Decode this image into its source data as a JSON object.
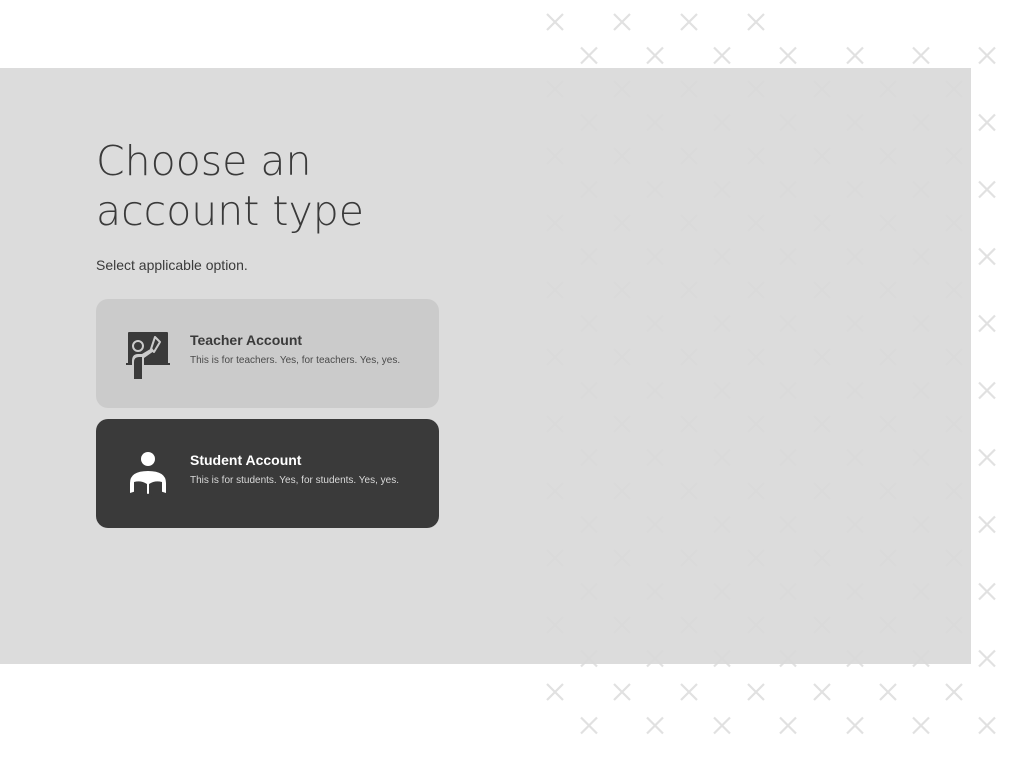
{
  "heading": {
    "line1": "Choose an",
    "line2": "account type"
  },
  "subtitle": "Select applicable option.",
  "options": [
    {
      "title": "Teacher Account",
      "description": "This is for teachers. Yes, for teachers. Yes, yes.",
      "icon": "teacher-icon",
      "selected": false
    },
    {
      "title": "Student Account",
      "description": "This is for students. Yes, for students. Yes, yes.",
      "icon": "student-icon",
      "selected": true
    }
  ],
  "colors": {
    "panel": "#d9d9d9",
    "text": "#3a3a3a",
    "card_default": "#cbcbcb",
    "card_selected": "#3a3a3a",
    "pattern": "#e1e1e1"
  }
}
